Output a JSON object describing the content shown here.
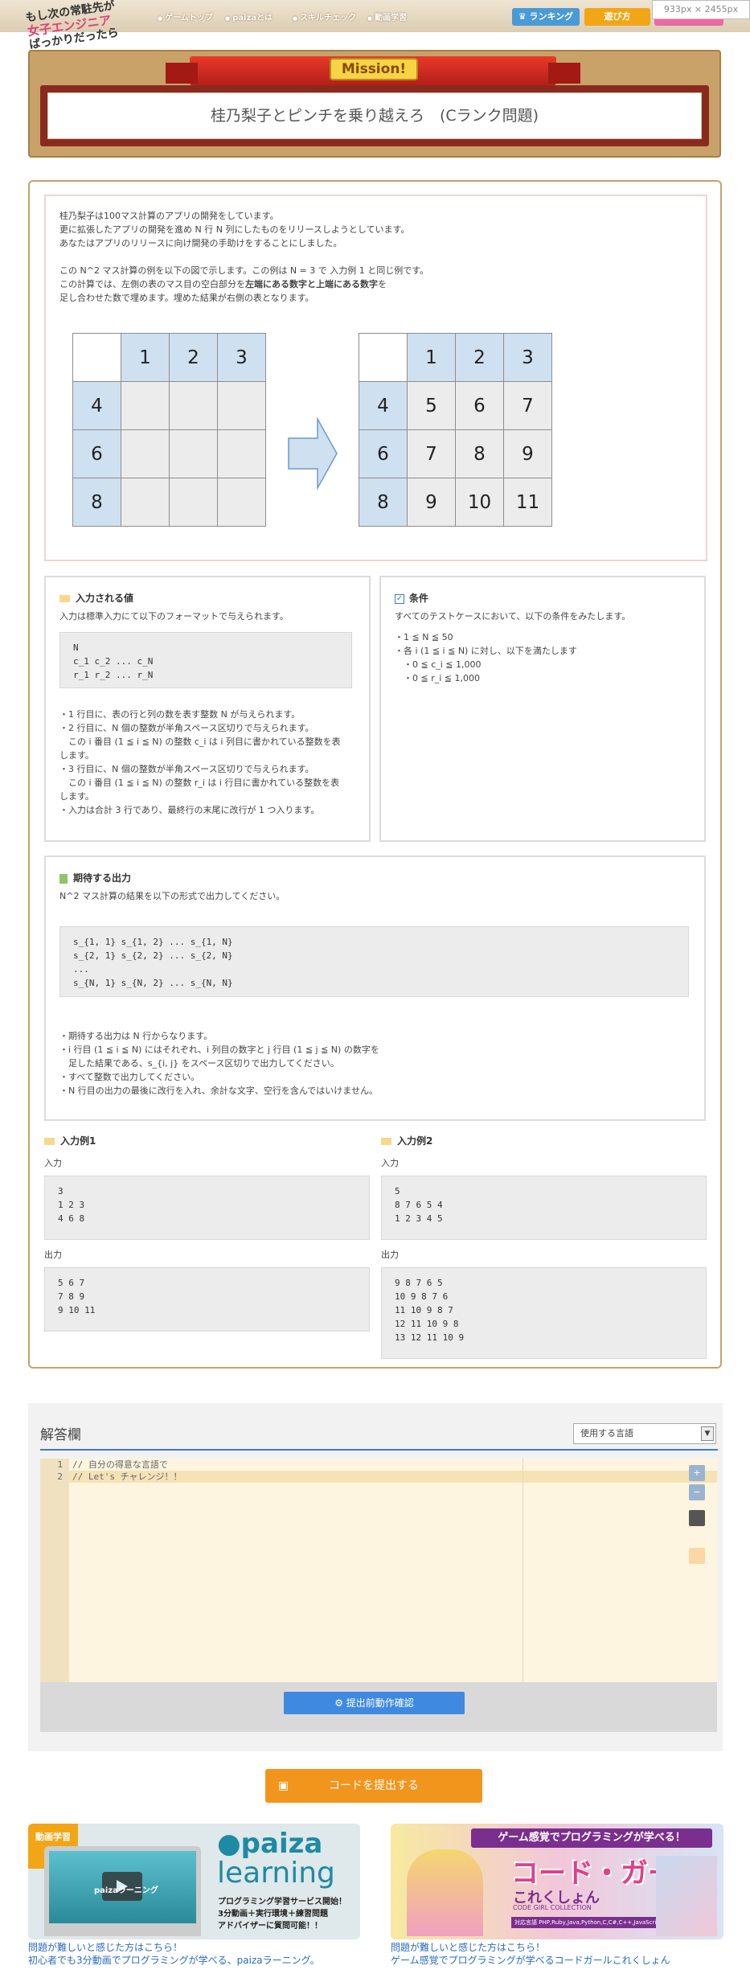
{
  "header": {
    "logo_line1": "もし次の常駐先が",
    "logo_line2": "女子エンジニア",
    "logo_line3": "ばっかりだったら",
    "nav": [
      "ゲームトップ",
      "paizaとは",
      "スキルチェック",
      "動画学習"
    ],
    "ranking_label": "ランキング",
    "howto_label": "遊び方",
    "dimension_overlay": "933px × 2455px"
  },
  "mission": {
    "label": "Mission!",
    "title": "桂乃梨子とピンチを乗り越えろ　(Cランク問題)"
  },
  "description": {
    "para1": [
      "桂乃梨子は100マス計算のアプリの開発をしています。",
      "更に拡張したアプリの開発を進め N 行 N 列にしたものをリリースしようとしています。",
      "あなたはアプリのリリースに向け開発の手助けをすることにしました。"
    ],
    "para2_l1": "この N^2 マス計算の例を以下の図で示します。この例は N = 3 で 入力例 1 と同じ例です。",
    "para2_l2a": "この計算では、左側の表のマス目の空白部分を",
    "para2_l2b": "左端にある数字と上端にある数字",
    "para2_l2c": "を",
    "para2_l3": "足し合わせた数で埋めます。埋めた結果が右側の表となります。",
    "left_table": [
      [
        "",
        "1",
        "2",
        "3"
      ],
      [
        "4",
        "",
        "",
        ""
      ],
      [
        "6",
        "",
        "",
        ""
      ],
      [
        "8",
        "",
        "",
        ""
      ]
    ],
    "right_table": [
      [
        "",
        "1",
        "2",
        "3"
      ],
      [
        "4",
        "5",
        "6",
        "7"
      ],
      [
        "6",
        "7",
        "8",
        "9"
      ],
      [
        "8",
        "9",
        "10",
        "11"
      ]
    ]
  },
  "input_section": {
    "title": "入力される値",
    "intro": "入力は標準入力にて以下のフォーマットで与えられます。",
    "format": "N\nc_1 c_2 ... c_N\nr_1 r_2 ... r_N",
    "notes": [
      "・1 行目に、表の行と列の数を表す整数 N が与えられます。",
      "・2 行目に、N 個の整数が半角スペース区切りで与えられます。",
      "　この i 番目 (1 ≦ i ≦ N) の整数 c_i は i 列目に書かれている整数を表",
      "します。",
      "・3 行目に、N 個の整数が半角スペース区切りで与えられます。",
      "　この i 番目 (1 ≦ i ≦ N) の整数 r_i は i 行目に書かれている整数を表",
      "します。",
      "・入力は合計 3 行であり、最終行の末尾に改行が 1 つ入ります。"
    ]
  },
  "conditions": {
    "title": "条件",
    "intro": "すべてのテストケースにおいて、以下の条件をみたします。",
    "items": [
      "・1 ≦ N ≦ 50",
      "・各 i (1 ≦ i ≦ N) に対し、以下を満たします",
      "　・0 ≦ c_i ≦ 1,000",
      "　・0 ≦ r_i ≦ 1,000"
    ]
  },
  "expected_output": {
    "title": "期待する出力",
    "intro": "N^2 マス計算の結果を以下の形式で出力してください。",
    "format": "s_{1, 1} s_{1, 2} ... s_{1, N}\ns_{2, 1} s_{2, 2} ... s_{2, N}\n...\ns_{N, 1} s_{N, 2} ... s_{N, N}",
    "notes": [
      "・期待する出力は N 行からなります。",
      "・i 行目 (1 ≦ i ≦ N) にはそれぞれ、i 列目の数字と j 行目 (1 ≦ j ≦ N) の数字を",
      "　足した結果である、s_{i, j} をスペース区切りで出力してください。",
      "・すべて整数で出力してください。",
      "・N 行目の出力の最後に改行を入れ、余計な文字、空行を含んではいけません。"
    ]
  },
  "examples": [
    {
      "title": "入力例1",
      "input_label": "入力",
      "input": "3\n1 2 3\n4 6 8",
      "output_label": "出力",
      "output": "5 6 7\n7 8 9\n9 10 11"
    },
    {
      "title": "入力例2",
      "input_label": "入力",
      "input": "5\n8 7 6 5 4\n1 2 3 4 5",
      "output_label": "出力",
      "output": "9 8 7 6 5\n10 9 8 7 6\n11 10 9 8 7\n12 11 10 9 8\n13 12 11 10 9"
    }
  ],
  "answer": {
    "title": "解答欄",
    "language_select": "使用する言語",
    "code_lines": [
      {
        "num": "1",
        "text": "// 自分の得意な言語で"
      },
      {
        "num": "2",
        "text": "// Let's チャレンジ！！"
      }
    ],
    "check_button": "提出前動作確認",
    "submit_button": "コードを提出する"
  },
  "banners": [
    {
      "badge": "動画学習",
      "brand": "paiza",
      "brand2": "learning",
      "screen_label": "paizaラーニング",
      "copy": [
        "プログラミング学習サービス開始！",
        "3分動画＋実行環境＋練習問題",
        "アドバイザーに質問可能！！"
      ],
      "link1": "問題が難しいと感じた方はこちら！",
      "link2": "初心者でも3分動画でプログラミングが学べる、paizaラーニング。"
    },
    {
      "headline": "ゲーム感覚でプログラミングが学べる！",
      "title": "コード・ガール",
      "subtitle": "これくしょん",
      "sub_en": "CODE GIRL COLLECTION",
      "langs": "対応言語 PHP,Ruby,Java,Python,C,C#,C++,JavaScript",
      "link1": "問題が難しいと感じた方はこちら！",
      "link2": "ゲーム感覚でプログラミングが学べるコードガールこれくしょん"
    }
  ],
  "colors": {
    "accent_blue": "#3f8ae0",
    "submit_orange": "#f2951c",
    "panel_border": "#c8a06a",
    "header_cell": "#cfe0f0"
  }
}
